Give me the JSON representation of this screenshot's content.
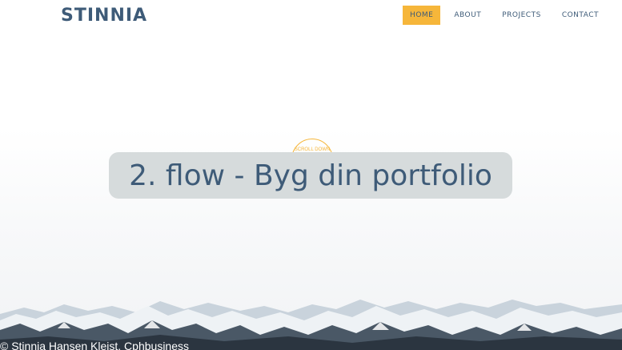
{
  "header": {
    "logo": "STINNIA",
    "nav": [
      {
        "label": "HOME",
        "active": true
      },
      {
        "label": "ABOUT",
        "active": false
      },
      {
        "label": "PROJECTS",
        "active": false
      },
      {
        "label": "CONTACT",
        "active": false
      }
    ]
  },
  "hero": {
    "scroll_label": "SCROLL DOWN",
    "title": "2. flow - Byg din portfolio"
  },
  "footer": {
    "copyright": "© Stinnia Hansen Kleist, Cphbusiness"
  },
  "colors": {
    "accent": "#f6b63a",
    "brand": "#3e5b78",
    "title_box": "#d6dbdc"
  }
}
